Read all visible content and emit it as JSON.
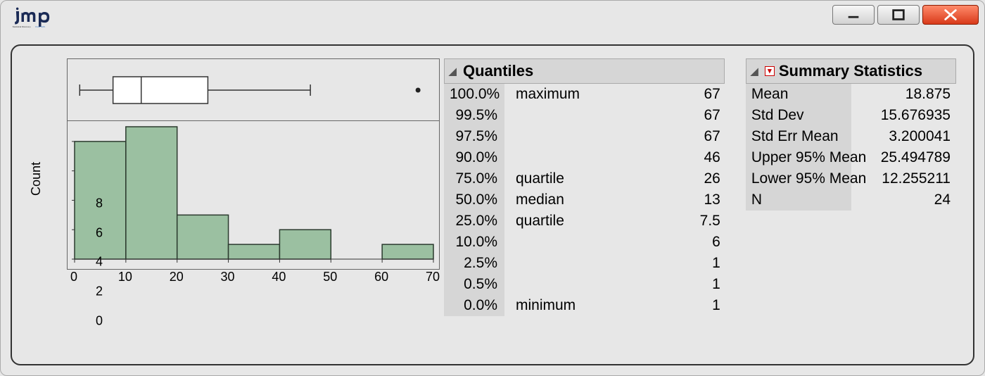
{
  "chart_data": {
    "histogram": {
      "type": "bar",
      "xlabel": "",
      "ylabel": "Count",
      "categories": [
        "0–10",
        "10–20",
        "20–30",
        "30–40",
        "40–50",
        "50–60",
        "60–70"
      ],
      "bin_edges": [
        0,
        10,
        20,
        30,
        40,
        50,
        60,
        70
      ],
      "values": [
        8,
        9,
        3,
        1,
        2,
        0,
        1
      ],
      "x_ticks": [
        0,
        10,
        20,
        30,
        40,
        50,
        60,
        70
      ],
      "y_ticks": [
        0,
        2,
        4,
        6,
        8
      ],
      "xlim": [
        0,
        70
      ],
      "ylim": [
        0,
        9
      ]
    },
    "boxplot": {
      "type": "box",
      "min_whisker": 1,
      "q1": 7.5,
      "median": 13,
      "q3": 26,
      "max_whisker": 46,
      "outliers": [
        67
      ]
    }
  },
  "quantiles": {
    "header": "Quantiles",
    "rows": [
      {
        "pct": "100.0%",
        "label": "maximum",
        "value": "67"
      },
      {
        "pct": "99.5%",
        "label": "",
        "value": "67"
      },
      {
        "pct": "97.5%",
        "label": "",
        "value": "67"
      },
      {
        "pct": "90.0%",
        "label": "",
        "value": "46"
      },
      {
        "pct": "75.0%",
        "label": "quartile",
        "value": "26"
      },
      {
        "pct": "50.0%",
        "label": "median",
        "value": "13"
      },
      {
        "pct": "25.0%",
        "label": "quartile",
        "value": "7.5"
      },
      {
        "pct": "10.0%",
        "label": "",
        "value": "6"
      },
      {
        "pct": "2.5%",
        "label": "",
        "value": "1"
      },
      {
        "pct": "0.5%",
        "label": "",
        "value": "1"
      },
      {
        "pct": "0.0%",
        "label": "minimum",
        "value": "1"
      }
    ]
  },
  "stats": {
    "header": "Summary Statistics",
    "rows": [
      {
        "name": "Mean",
        "value": "18.875"
      },
      {
        "name": "Std Dev",
        "value": "15.676935"
      },
      {
        "name": "Std Err Mean",
        "value": "3.200041"
      },
      {
        "name": "Upper 95% Mean",
        "value": "25.494789"
      },
      {
        "name": "Lower 95% Mean",
        "value": "12.255211"
      },
      {
        "name": "N",
        "value": "24"
      }
    ]
  }
}
